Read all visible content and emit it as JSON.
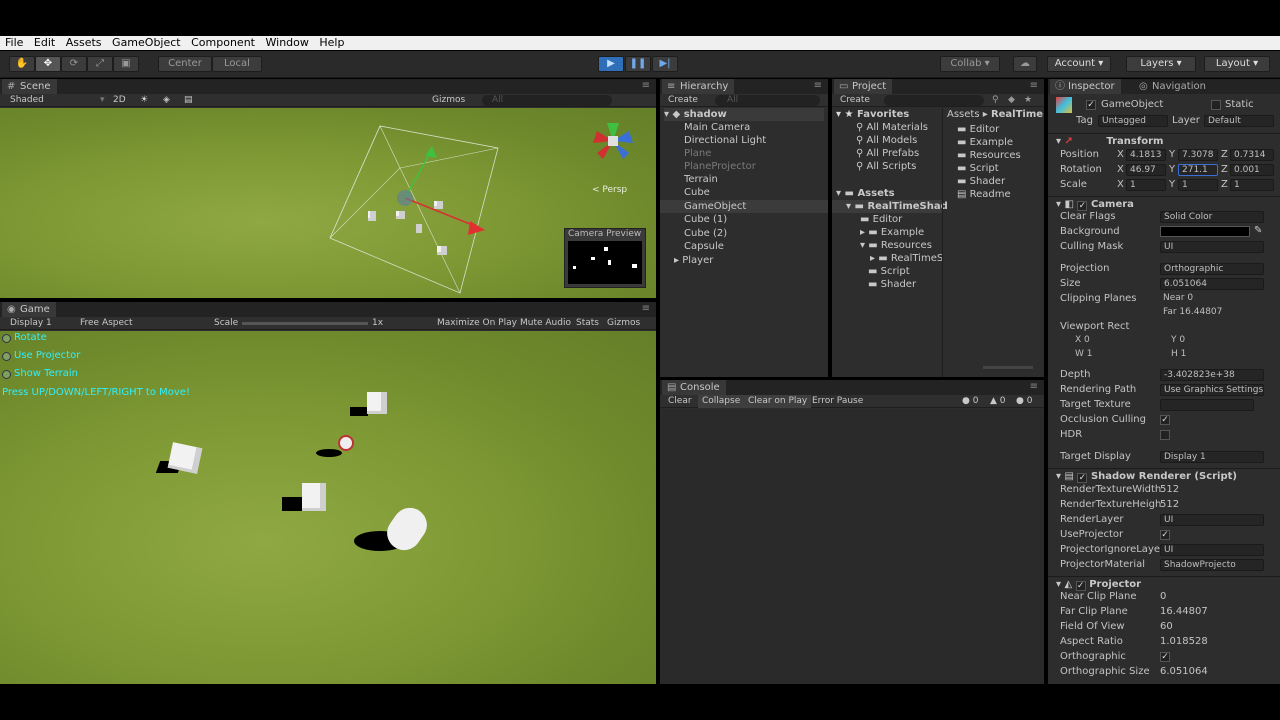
{
  "menu": [
    "File",
    "Edit",
    "Assets",
    "GameObject",
    "Component",
    "Window",
    "Help"
  ],
  "toolbar": {
    "center": "Center",
    "local": "Local",
    "collab": "Collab",
    "account": "Account",
    "layers": "Layers",
    "layout": "Layout"
  },
  "scene": {
    "tab": "Scene",
    "shaded": "Shaded",
    "mode_2d": "2D",
    "gizmos": "Gizmos",
    "search": "All",
    "persp": "< Persp",
    "camera_preview": "Camera Preview"
  },
  "game": {
    "tab": "Game",
    "display": "Display 1",
    "aspect": "Free Aspect",
    "scale": "Scale",
    "scale_val": "1x",
    "maximize": "Maximize On Play",
    "mute": "Mute Audio",
    "stats": "Stats",
    "gizmos": "Gizmos",
    "toggles": [
      "Rotate",
      "Use Projector",
      "Show Terrain"
    ],
    "hint": "Press UP/DOWN/LEFT/RIGHT to Move!"
  },
  "hierarchy": {
    "tab": "Hierarchy",
    "create": "Create",
    "search": "All",
    "scene": "shadow",
    "items": [
      "Main Camera",
      "Directional Light",
      "Plane",
      "PlaneProjector",
      "Terrain",
      "Cube",
      "GameObject",
      "Cube (1)",
      "Cube (2)",
      "Capsule",
      "Player"
    ]
  },
  "project": {
    "tab": "Project",
    "create": "Create",
    "favorites": "Favorites",
    "fav_items": [
      "All Materials",
      "All Models",
      "All Prefabs",
      "All Scripts"
    ],
    "assets": "Assets",
    "tree": [
      "RealTimeShad",
      "Editor",
      "Example",
      "Resources",
      "RealTimeS",
      "Script",
      "Shader"
    ],
    "breadcrumb": [
      "Assets",
      "RealTime"
    ],
    "files": [
      "Editor",
      "Example",
      "Resources",
      "Script",
      "Shader",
      "Readme"
    ]
  },
  "console": {
    "tab": "Console",
    "buttons": [
      "Clear",
      "Collapse",
      "Clear on Play",
      "Error Pause"
    ],
    "counts": [
      "0",
      "0",
      "0"
    ]
  },
  "inspector": {
    "tab": "Inspector",
    "nav_tab": "Navigation",
    "name": "GameObject",
    "static": "Static",
    "tag_label": "Tag",
    "tag": "Untagged",
    "layer_label": "Layer",
    "layer": "Default",
    "transform": {
      "title": "Transform",
      "position": "Position",
      "rotation": "Rotation",
      "scale": "Scale",
      "pos": [
        "X",
        "4.1813",
        "Y",
        "7.3078",
        "Z",
        "0.7314"
      ],
      "rot": [
        "X",
        "46.97",
        "Y",
        "271.1",
        "Z",
        "0.001"
      ],
      "scl": [
        "X",
        "1",
        "Y",
        "1",
        "Z",
        "1"
      ]
    },
    "camera": {
      "title": "Camera",
      "rows": [
        [
          "Clear Flags",
          "Solid Color"
        ],
        [
          "Background",
          ""
        ],
        [
          "Culling Mask",
          "UI"
        ],
        [
          "Projection",
          "Orthographic"
        ],
        [
          "Size",
          "6.051064"
        ],
        [
          "Clipping Planes",
          "Near  0"
        ],
        [
          "",
          "Far    16.44807"
        ]
      ],
      "viewport": "Viewport Rect",
      "vx": "X  0",
      "vy": "Y  0",
      "vw": "W 1",
      "vh": "H 1",
      "rows2": [
        [
          "Depth",
          "-3.402823e+38"
        ],
        [
          "Rendering Path",
          "Use Graphics Settings"
        ],
        [
          "Target Texture",
          ""
        ],
        [
          "Occlusion Culling",
          ""
        ],
        [
          "HDR",
          ""
        ],
        [
          "Target Display",
          "Display 1"
        ]
      ]
    },
    "shadow": {
      "title": "Shadow Renderer (Script)",
      "rows": [
        [
          "RenderTextureWidth",
          "512"
        ],
        [
          "RenderTextureHeigh",
          "512"
        ],
        [
          "RenderLayer",
          "UI"
        ],
        [
          "UseProjector",
          ""
        ],
        [
          "ProjectorIgnoreLaye",
          "UI"
        ],
        [
          "ProjectorMaterial",
          "ShadowProjecto"
        ]
      ]
    },
    "projector": {
      "title": "Projector",
      "rows": [
        [
          "Near Clip Plane",
          "0"
        ],
        [
          "Far Clip Plane",
          "16.44807"
        ],
        [
          "Field Of View",
          "60"
        ],
        [
          "Aspect Ratio",
          "1.018528"
        ],
        [
          "Orthographic",
          ""
        ],
        [
          "Orthographic Size",
          "6.051064"
        ]
      ]
    }
  }
}
